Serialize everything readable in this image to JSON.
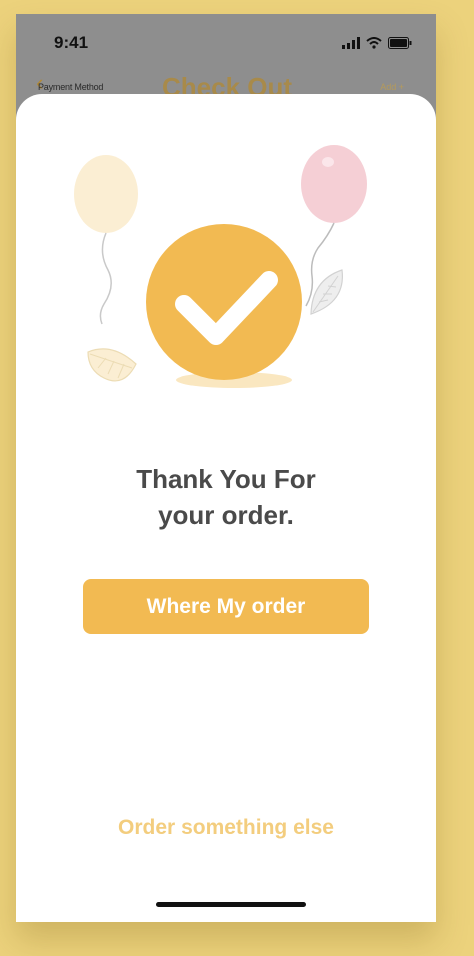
{
  "status_bar": {
    "time": "9:41",
    "icons": [
      "signal-icon",
      "wifi-icon",
      "battery-icon"
    ]
  },
  "background_nav": {
    "back_icon": "chevron-left-icon",
    "back_label": "Payment Method",
    "title": "Check Out",
    "right_label": "Add +"
  },
  "confirmation": {
    "illustration_icons": [
      "balloon-icon",
      "checkmark-icon",
      "leaf-icon"
    ],
    "message_line1": "Thank You For",
    "message_line2": "your order.",
    "primary_button_label": "Where My order",
    "secondary_link_label": "Order something else"
  },
  "colors": {
    "accent": "#f2ba52",
    "accent_light": "#f3cd7e",
    "background": "#ecd27c",
    "text_dark": "#4a4a4a"
  }
}
